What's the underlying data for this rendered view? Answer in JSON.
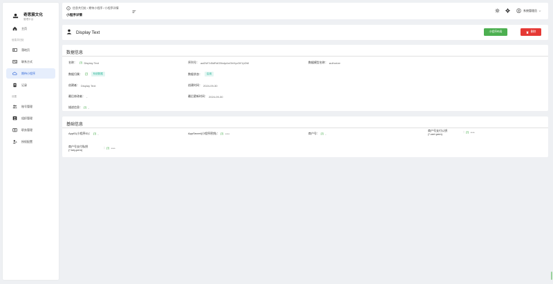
{
  "brand": {
    "title": "奇思宸文化",
    "subtitle": "管理平台"
  },
  "nav": {
    "home": "主页",
    "group_info": "信息共归处",
    "items": [
      "落地页",
      "联系方式",
      "期待小程序",
      "记录"
    ],
    "group_settings": "设置",
    "settings": [
      "账号管理",
      "组织管理",
      "职务管理",
      "授权配置"
    ]
  },
  "header": {
    "breadcrumb": "信息共归处 / 期待小程序 / 小程序详情",
    "page_title": "小程序详情",
    "user": "系统管理员"
  },
  "detail": {
    "title": "Display Text",
    "layout_button": "小程序布局",
    "delete_button": "删除"
  },
  "data_info": {
    "title": "数据信息",
    "name_label": "名称：",
    "name_value": "Display Text",
    "serial_label": "序列号：",
    "serial_value": "aaDW7d5dRdG5bdpAnGhHyx3KYpDM",
    "model_label": "数据模型名称：",
    "model_value": "authorize",
    "archive_label": "数据归属：",
    "archive_value": "系统数据",
    "status_label": "数据状态：",
    "status_value": "启用",
    "creator_label": "创建者：",
    "creator_value": "Display Text",
    "created_label": "创建时间：",
    "created_value": "2024-09-30",
    "modifier_label": "最后修改者：",
    "modifier_value": "-",
    "updated_label": "最后更新时间：",
    "updated_value": "2024-09-30",
    "desc_label": "描述信息：",
    "desc_value": "-"
  },
  "base_info": {
    "title": "基础信息",
    "appid_label": "AppID(小程序ID)：",
    "appid_value": "-",
    "secret_label": "AppSecret(小程序密钥)：",
    "secret_value": "****",
    "merchant_label": "商户号：",
    "merchant_value": "-",
    "cert_label": "商户号支付公钥(*.cert.pem)",
    "cert_value": "****",
    "key_label": "商户号支付私钥(*.key.pem)",
    "key_value": "****"
  }
}
